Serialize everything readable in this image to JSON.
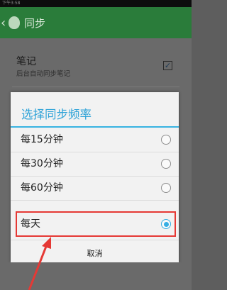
{
  "status_bar": {
    "time": "下午3:58"
  },
  "app_bar": {
    "title": "同步"
  },
  "settings": {
    "title": "笔记",
    "subtitle": "后台自动同步笔记",
    "checked": true
  },
  "dialog": {
    "title": "选择同步频率",
    "options": [
      {
        "label": "每15分钟",
        "selected": false
      },
      {
        "label": "每30分钟",
        "selected": false
      },
      {
        "label": "每60分钟",
        "selected": false
      },
      {
        "label": "每天",
        "selected": true
      }
    ],
    "cancel_label": "取消"
  },
  "colors": {
    "accent": "#36aee3",
    "app_bar": "#2a7c3a",
    "highlight": "#e53935"
  }
}
